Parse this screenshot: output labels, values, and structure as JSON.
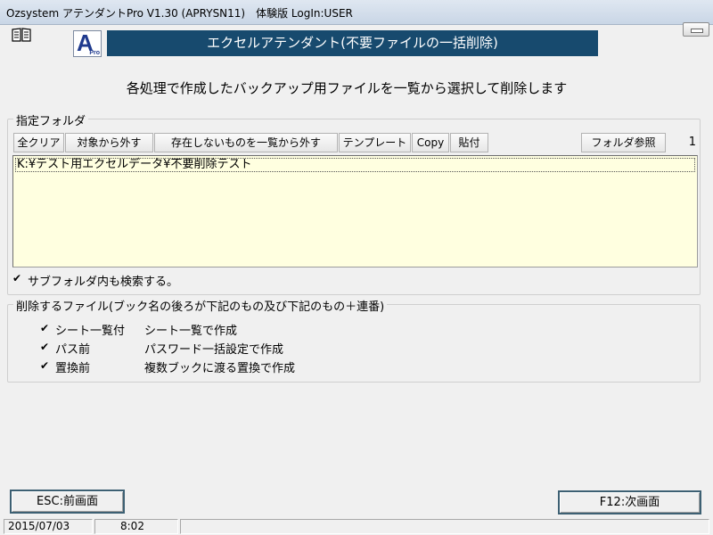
{
  "window": {
    "title": "Ozsystem アテンダントPro V1.30 (APRYSN11)　体験版 LogIn:USER"
  },
  "header": {
    "logo_letter": "A",
    "logo_sub": "Pro",
    "title": "エクセルアテンダント(不要ファイルの一括削除)"
  },
  "description": "各処理で作成したバックアップ用ファイルを一覧から選択して削除します",
  "folder_section": {
    "legend": "指定フォルダ",
    "toolbar": [
      {
        "label": "全クリア"
      },
      {
        "label": "対象から外す"
      },
      {
        "label": "存在しないものを一覧から外す"
      },
      {
        "label": "テンプレート"
      },
      {
        "label": "Copy"
      },
      {
        "label": "貼付"
      }
    ],
    "browse_label": "フォルダ参照",
    "count": "1",
    "folders": [
      "K:¥テスト用エクセルデータ¥不要削除テスト"
    ],
    "subfolder_checked": true,
    "subfolder_label": "サブフォルダ内も検索する。"
  },
  "delete_section": {
    "legend": "削除するファイル(ブック名の後ろが下記のもの及び下記のもの＋連番)",
    "files": [
      {
        "checked": true,
        "name": "シート一覧付",
        "desc": "シート一覧で作成"
      },
      {
        "checked": true,
        "name": "パス前",
        "desc": "パスワード一括設定で作成"
      },
      {
        "checked": true,
        "name": "置換前",
        "desc": "複数ブックに渡る置換で作成"
      }
    ]
  },
  "nav": {
    "esc_label": "ESC:前画面",
    "f12_label": "F12:次画面"
  },
  "status": {
    "date": "2015/07/03",
    "time": "8:02"
  },
  "icons": {
    "app_menu": "book-icon",
    "checkbox": "check-mark"
  },
  "colors": {
    "header_bar": "#174a6e",
    "list_background": "#ffffe0",
    "logo_text": "#1f3a8e"
  }
}
